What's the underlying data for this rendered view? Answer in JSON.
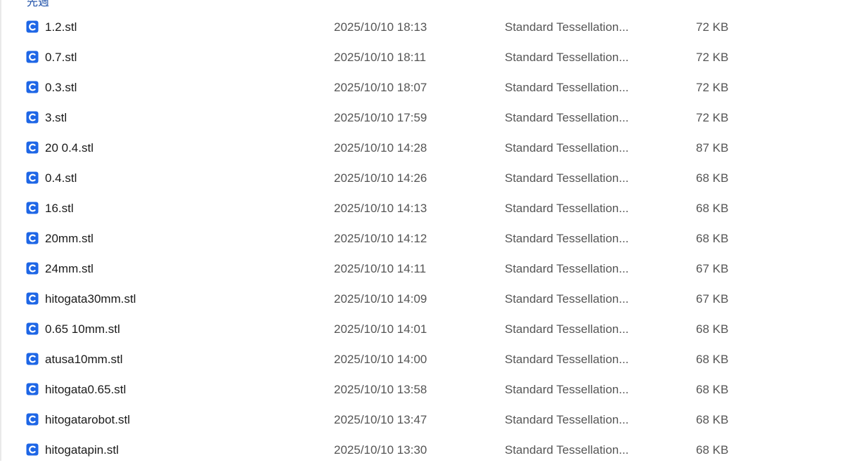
{
  "group_header": "先週",
  "colors": {
    "accent": "#1e66e6",
    "header": "#1e50a8"
  },
  "file_icon": "stl-file-icon",
  "files": [
    {
      "name": "1.2.stl",
      "date": "2025/10/10 18:13",
      "type": "Standard Tessellation...",
      "size": "72 KB"
    },
    {
      "name": "0.7.stl",
      "date": "2025/10/10 18:11",
      "type": "Standard Tessellation...",
      "size": "72 KB"
    },
    {
      "name": "0.3.stl",
      "date": "2025/10/10 18:07",
      "type": "Standard Tessellation...",
      "size": "72 KB"
    },
    {
      "name": "3.stl",
      "date": "2025/10/10 17:59",
      "type": "Standard Tessellation...",
      "size": "72 KB"
    },
    {
      "name": "20 0.4.stl",
      "date": "2025/10/10 14:28",
      "type": "Standard Tessellation...",
      "size": "87 KB"
    },
    {
      "name": "0.4.stl",
      "date": "2025/10/10 14:26",
      "type": "Standard Tessellation...",
      "size": "68 KB"
    },
    {
      "name": "16.stl",
      "date": "2025/10/10 14:13",
      "type": "Standard Tessellation...",
      "size": "68 KB"
    },
    {
      "name": "20mm.stl",
      "date": "2025/10/10 14:12",
      "type": "Standard Tessellation...",
      "size": "68 KB"
    },
    {
      "name": "24mm.stl",
      "date": "2025/10/10 14:11",
      "type": "Standard Tessellation...",
      "size": "67 KB"
    },
    {
      "name": "hitogata30mm.stl",
      "date": "2025/10/10 14:09",
      "type": "Standard Tessellation...",
      "size": "67 KB"
    },
    {
      "name": "0.65 10mm.stl",
      "date": "2025/10/10 14:01",
      "type": "Standard Tessellation...",
      "size": "68 KB"
    },
    {
      "name": "atusa10mm.stl",
      "date": "2025/10/10 14:00",
      "type": "Standard Tessellation...",
      "size": "68 KB"
    },
    {
      "name": "hitogata0.65.stl",
      "date": "2025/10/10 13:58",
      "type": "Standard Tessellation...",
      "size": "68 KB"
    },
    {
      "name": "hitogatarobot.stl",
      "date": "2025/10/10 13:47",
      "type": "Standard Tessellation...",
      "size": "68 KB"
    },
    {
      "name": "hitogatapin.stl",
      "date": "2025/10/10 13:30",
      "type": "Standard Tessellation...",
      "size": "68 KB"
    }
  ]
}
